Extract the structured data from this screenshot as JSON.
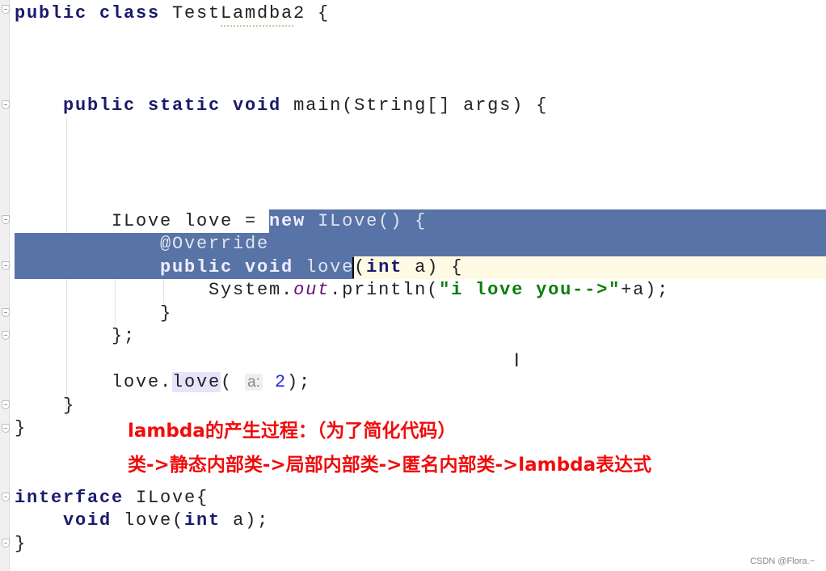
{
  "editor": {
    "lines": [
      [
        [
          "public class ",
          "kw"
        ],
        [
          "TestLamdba2 {",
          "plain"
        ]
      ],
      [],
      [],
      [],
      [
        [
          "    public static void ",
          "kw"
        ],
        [
          "main(String[] args) {",
          "plain"
        ]
      ],
      [],
      [],
      [],
      [],
      [
        [
          "        ILove love = ",
          "plain"
        ],
        [
          "new",
          "kw sel"
        ],
        [
          " ILove() {",
          "plain sel"
        ]
      ],
      [
        [
          "            @Override",
          "plain sel"
        ]
      ],
      [
        [
          "            public void ",
          "kw sel"
        ],
        [
          "love",
          "plain sel"
        ],
        [
          "(",
          "plain"
        ],
        [
          "int",
          "kw"
        ],
        [
          " a) {",
          "plain"
        ]
      ],
      [
        [
          "                System.",
          "plain"
        ],
        [
          "out",
          "field"
        ],
        [
          ".println(",
          "plain"
        ],
        [
          "\"i love you-->\"",
          "str"
        ],
        [
          "+a);",
          "plain"
        ]
      ],
      [
        [
          "            }",
          "plain"
        ]
      ],
      [
        [
          "        };",
          "plain"
        ]
      ],
      [],
      [
        [
          "        love.",
          "plain"
        ],
        [
          "love",
          "plain call"
        ],
        [
          "( ",
          "plain"
        ],
        [
          "a:",
          "hint"
        ],
        [
          " ",
          "plain"
        ],
        [
          "2",
          "num"
        ],
        [
          ");",
          "plain"
        ]
      ],
      [
        [
          "    }",
          "plain"
        ]
      ],
      [
        [
          "}",
          "plain"
        ]
      ],
      [],
      [],
      [
        [
          "interface ",
          "kw"
        ],
        [
          "ILove{",
          "plain"
        ]
      ],
      [
        [
          "    void ",
          "kw"
        ],
        [
          "love(",
          "plain"
        ],
        [
          "int",
          "kw"
        ],
        [
          " a);",
          "plain"
        ]
      ],
      [
        [
          "}",
          "plain"
        ]
      ]
    ]
  },
  "notes": {
    "line1": "lambda的产生过程：（为了简化代码）",
    "line2": "类->静态内部类->局部内部类->匿名内部类->lambda表达式"
  },
  "watermark": "CSDN @Flora.~",
  "colors": {
    "selection": "#5873a6",
    "note": "#f00c0c",
    "keyword": "#1a1a6e",
    "string": "#0b7d0b"
  }
}
